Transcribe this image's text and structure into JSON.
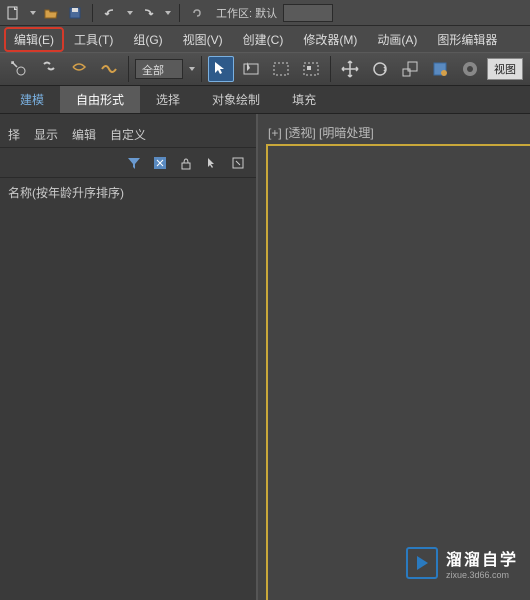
{
  "toolbar": {
    "workspace_label": "工作区: 默认"
  },
  "menu": {
    "edit": "编辑(E)",
    "tools": "工具(T)",
    "group": "组(G)",
    "view": "视图(V)",
    "create": "创建(C)",
    "modifiers": "修改器(M)",
    "animation": "动画(A)",
    "graph": "图形编辑器"
  },
  "ribbon": {
    "selection_mode": "全部",
    "view_label": "视图"
  },
  "tabs": {
    "model": "建模",
    "freeform": "自由形式",
    "select": "选择",
    "objectpaint": "对象绘制",
    "fill": "填充"
  },
  "panel": {
    "menu_select": "择",
    "menu_display": "显示",
    "menu_edit": "编辑",
    "menu_custom": "自定义",
    "header": "名称(按年龄升序排序)"
  },
  "viewport": {
    "label": "[+] [透视] [明暗处理]"
  },
  "watermark": {
    "title": "溜溜自学",
    "url": "zixue.3d66.com"
  }
}
